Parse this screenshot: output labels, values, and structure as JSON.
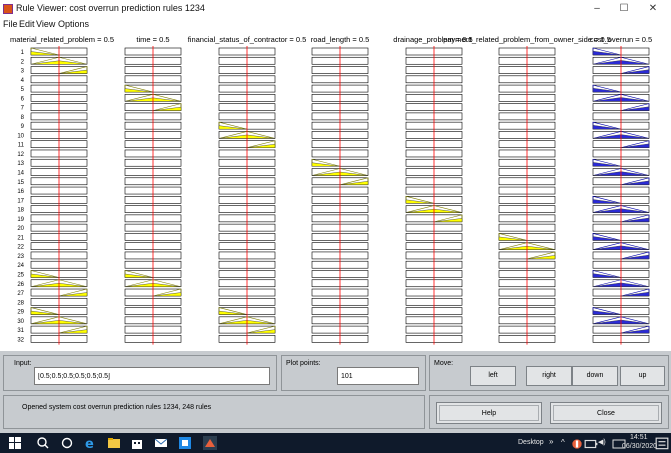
{
  "window": {
    "title": "Rule Viewer: cost overrun prediction rules 1234",
    "minimize": "–",
    "maximize": "☐",
    "close": "✕"
  },
  "menu": {
    "file": "File",
    "edit": "Edit",
    "view": "View",
    "options": "Options"
  },
  "columns": [
    {
      "label": "material_related_problem = 0.5",
      "kind": "input"
    },
    {
      "label": "time = 0.5",
      "kind": "input"
    },
    {
      "label": "financial_status_of_contractor = 0.5",
      "kind": "input"
    },
    {
      "label": "road_length = 0.5",
      "kind": "input"
    },
    {
      "label": "drainage_problem = 0.5",
      "kind": "input"
    },
    {
      "label": "payment_related_problem_from_owner_side = 0.5",
      "kind": "input"
    },
    {
      "label": "cost_overrun = 0.5",
      "kind": "output"
    }
  ],
  "rule_numbers": [
    "1",
    "2",
    "3",
    "4",
    "5",
    "6",
    "7",
    "8",
    "9",
    "10",
    "11",
    "12",
    "13",
    "14",
    "15",
    "16",
    "17",
    "18",
    "19",
    "20",
    "21",
    "22",
    "23",
    "24",
    "25",
    "26",
    "27",
    "28",
    "29",
    "30",
    "31",
    "32"
  ],
  "rule_active_mf": [
    [
      0,
      -1,
      -1,
      -1,
      -1,
      -1,
      0
    ],
    [
      1,
      -1,
      -1,
      -1,
      -1,
      -1,
      1
    ],
    [
      2,
      -1,
      -1,
      -1,
      -1,
      -1,
      2
    ],
    [
      -1,
      -1,
      -1,
      -1,
      -1,
      -1,
      -1
    ],
    [
      -1,
      0,
      -1,
      -1,
      -1,
      -1,
      0
    ],
    [
      -1,
      1,
      -1,
      -1,
      -1,
      -1,
      1
    ],
    [
      -1,
      2,
      -1,
      -1,
      -1,
      -1,
      2
    ],
    [
      -1,
      -1,
      -1,
      -1,
      -1,
      -1,
      -1
    ],
    [
      -1,
      -1,
      0,
      -1,
      -1,
      -1,
      0
    ],
    [
      -1,
      -1,
      1,
      -1,
      -1,
      -1,
      1
    ],
    [
      -1,
      -1,
      2,
      -1,
      -1,
      -1,
      2
    ],
    [
      -1,
      -1,
      -1,
      -1,
      -1,
      -1,
      -1
    ],
    [
      -1,
      -1,
      -1,
      0,
      -1,
      -1,
      0
    ],
    [
      -1,
      -1,
      -1,
      1,
      -1,
      -1,
      1
    ],
    [
      -1,
      -1,
      -1,
      2,
      -1,
      -1,
      2
    ],
    [
      -1,
      -1,
      -1,
      -1,
      -1,
      -1,
      -1
    ],
    [
      -1,
      -1,
      -1,
      -1,
      0,
      -1,
      0
    ],
    [
      -1,
      -1,
      -1,
      -1,
      1,
      -1,
      1
    ],
    [
      -1,
      -1,
      -1,
      -1,
      2,
      -1,
      2
    ],
    [
      -1,
      -1,
      -1,
      -1,
      -1,
      -1,
      -1
    ],
    [
      -1,
      -1,
      -1,
      -1,
      -1,
      0,
      0
    ],
    [
      -1,
      -1,
      -1,
      -1,
      -1,
      1,
      1
    ],
    [
      -1,
      -1,
      -1,
      -1,
      -1,
      2,
      2
    ],
    [
      -1,
      -1,
      -1,
      -1,
      -1,
      -1,
      -1
    ],
    [
      0,
      0,
      -1,
      -1,
      -1,
      -1,
      0
    ],
    [
      1,
      1,
      -1,
      -1,
      -1,
      -1,
      1
    ],
    [
      2,
      2,
      -1,
      -1,
      -1,
      -1,
      2
    ],
    [
      -1,
      -1,
      -1,
      -1,
      -1,
      -1,
      -1
    ],
    [
      0,
      -1,
      0,
      -1,
      -1,
      -1,
      0
    ],
    [
      1,
      -1,
      1,
      -1,
      -1,
      -1,
      1
    ],
    [
      2,
      -1,
      2,
      -1,
      -1,
      -1,
      2
    ],
    [
      -1,
      -1,
      -1,
      -1,
      -1,
      -1,
      -1
    ]
  ],
  "input_value": 0.5,
  "colors": {
    "input_fill": "#ffff00",
    "output_fill": "#2b2bd6",
    "marker_line": "#ff0000",
    "mf_line": "#808000",
    "output_line": "#0000aa"
  },
  "input_panel": {
    "label": "Input:",
    "value": "[0.5;0.5;0.5;0.5;0.5;0.5]"
  },
  "plot_points": {
    "label": "Plot points:",
    "value": "101"
  },
  "move": {
    "label": "Move:",
    "left": "left",
    "right": "right",
    "down": "down",
    "up": "up"
  },
  "status": {
    "text": "Opened system cost overrun prediction rules 1234, 248 rules"
  },
  "buttons": {
    "help": "Help",
    "close": "Close"
  },
  "taskbar": {
    "start_icon": "windows-logo-icon",
    "desktop_label": "Desktop",
    "overflow": "»",
    "time": "14:51",
    "date": "06/30/2020"
  }
}
